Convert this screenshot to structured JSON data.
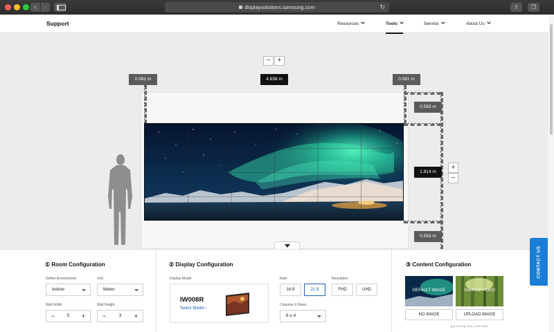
{
  "browser": {
    "url": "displaysolutions.samsung.com",
    "back_icon": "chevron-left-icon",
    "forward_icon": "chevron-right-icon",
    "reload_icon": "reload-icon"
  },
  "header": {
    "logo": "Support",
    "nav": [
      {
        "label": "Resources"
      },
      {
        "label": "Tools"
      },
      {
        "label": "Service"
      },
      {
        "label": "About Us"
      }
    ],
    "active_nav": "Tools"
  },
  "stage": {
    "zoom_out": "−",
    "zoom_in": "+",
    "left_margin": "0.081 m",
    "total_width": "4.838 m",
    "right_margin": "0.081 m",
    "top_margin": "0.593 m",
    "screen_height": "1.814 m",
    "bottom_margin": "0.593 m",
    "height_plus": "+",
    "height_minus": "−"
  },
  "room": {
    "title": "① Room Configuration",
    "env_label": "Define Environment",
    "env_value": "Indoor",
    "unit_label": "Unit",
    "unit_value": "Meter",
    "wall_width_label": "Wall Width",
    "wall_width_value": "5",
    "wall_height_label": "Wall Height",
    "wall_height_value": "3",
    "minus": "−",
    "plus": "+"
  },
  "display": {
    "title": "② Display Configuration",
    "model_label": "Display Model",
    "model_name": "IW008R",
    "select_model": "Select Model ›",
    "rate_label": "Rate",
    "rates": [
      "16:9",
      "21:9"
    ],
    "selected_rate": "21:9",
    "resolution_label": "Resolution",
    "resolutions": [
      "FHD",
      "UHD"
    ],
    "grid_label": "Columns X Rows",
    "grid_value": "6 x 4"
  },
  "content": {
    "title": "③ Content Configuration",
    "default_image": "DEFAULT IMAGE",
    "sample_video": "SAMPLE VIDEO",
    "no_image": "NO IMAGE",
    "upload_image": "UPLOAD IMAGE",
    "note": "jpg or png only, max 3mb"
  },
  "contact": "CONTACT US"
}
